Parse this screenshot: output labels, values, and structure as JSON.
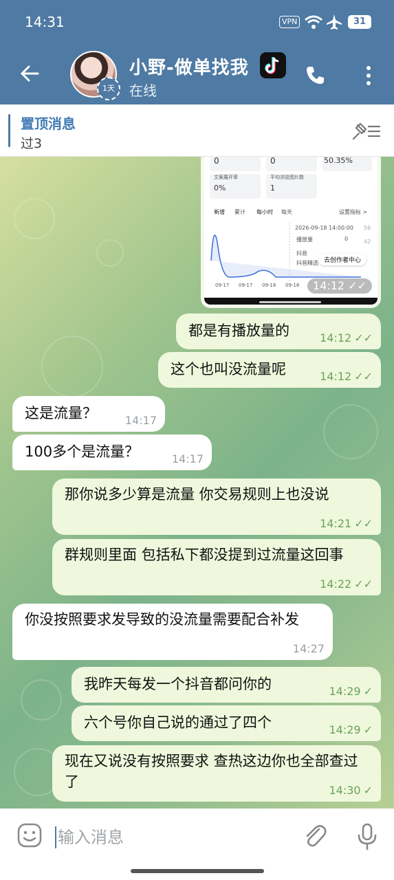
{
  "status_bar": {
    "time": "14:31",
    "vpn": "VPN",
    "battery": "31"
  },
  "header": {
    "contact_name": "小野-做单找我",
    "status": "在线",
    "story_badge": "1天"
  },
  "pinned": {
    "title": "置顶消息",
    "text": "过3"
  },
  "screenshot_preview": {
    "metrics": [
      {
        "value": "0"
      },
      {
        "value": "0"
      },
      {
        "value": "50.35%"
      },
      {
        "label": "文案展开率",
        "value": "0%"
      },
      {
        "label": "平均浏览图片数",
        "value": "1"
      }
    ],
    "tabs": [
      "新增",
      "累计",
      "每小时",
      "每天"
    ],
    "settings_link": "设置指标 >",
    "tooltip_time": "2026-09-18 14:00:00",
    "tooltip_metric": "播放量",
    "tooltip_value": "0",
    "legend_douyin": "抖音",
    "legend_other": "抖音精选",
    "creator_center": "去创作者中心",
    "x_labels": [
      "09-17",
      "09-17",
      "09-18",
      "09-18",
      "09-18",
      "09-18"
    ],
    "y_labels": [
      "56",
      "42"
    ],
    "time": "14:12"
  },
  "messages": [
    {
      "dir": "out",
      "text": "都是有播放量的",
      "time": "14:12",
      "read": true
    },
    {
      "dir": "out",
      "text": "这个也叫没流量呢",
      "time": "14:12",
      "read": true
    },
    {
      "dir": "in",
      "text": "这是流量？",
      "time": "14:17"
    },
    {
      "dir": "in",
      "text": "100多个是流量？",
      "time": "14:17"
    },
    {
      "dir": "out",
      "text": "那你说多少算是流量  你交易规则上也没说",
      "time": "14:21",
      "read": true
    },
    {
      "dir": "out",
      "text": "群规则里面  包括私下都没提到过流量这回事",
      "time": "14:22",
      "read": true
    },
    {
      "dir": "in",
      "text": "你没按照要求发导致的没流量需要配合补发",
      "time": "14:27"
    },
    {
      "dir": "out",
      "text": "我昨天每发一个抖音都问你的",
      "time": "14:29",
      "read": false
    },
    {
      "dir": "out",
      "text": "六个号你自己说的通过了四个",
      "time": "14:29",
      "read": false
    },
    {
      "dir": "out",
      "text": "现在又说没有按照要求  查热这边你也全部查过了",
      "time": "14:30",
      "read": false
    }
  ],
  "input": {
    "placeholder": "输入消息"
  },
  "icons": [
    "back-arrow-icon",
    "tiktok-icon",
    "phone-icon",
    "more-vertical-icon",
    "unpin-icon",
    "emoji-icon",
    "attach-icon",
    "mic-icon",
    "double-check-icon",
    "single-check-icon"
  ]
}
